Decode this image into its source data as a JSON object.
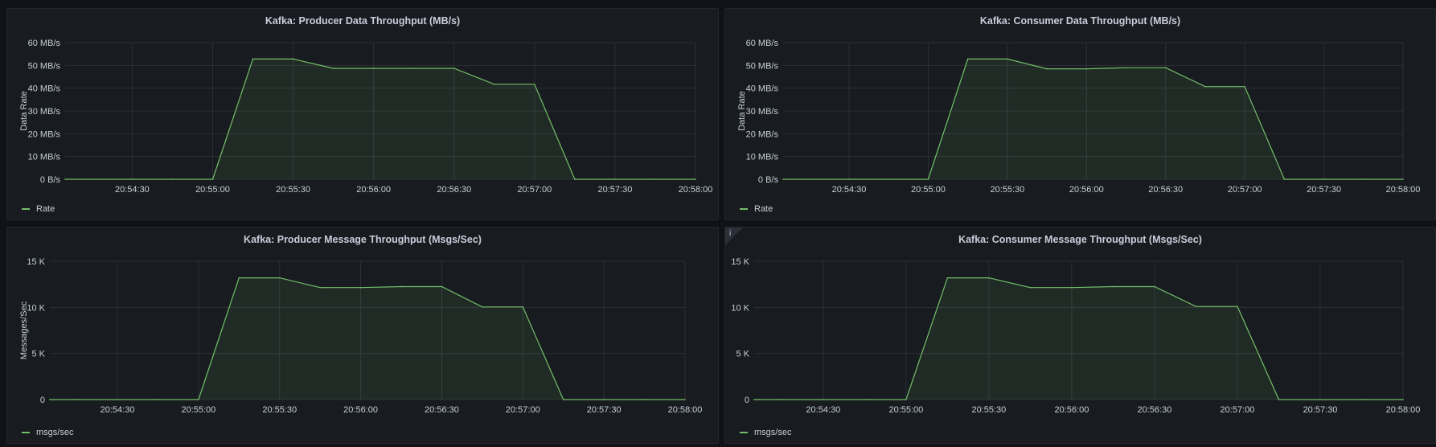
{
  "colors": {
    "line": "#73bf69",
    "grid": "#2c2f36",
    "axis_text": "#c7d0d9"
  },
  "chart_data": [
    {
      "type": "area",
      "title": "Kafka: Producer Data Throughput (MB/s)",
      "ylabel": "Data Rate",
      "xlabel": "",
      "y_ticks": [
        "0 B/s",
        "10 MB/s",
        "20 MB/s",
        "30 MB/s",
        "40 MB/s",
        "50 MB/s",
        "60 MB/s"
      ],
      "ylim": [
        0,
        60
      ],
      "x_ticks": [
        "20:54:30",
        "20:55:00",
        "20:55:30",
        "20:56:00",
        "20:56:30",
        "20:57:00",
        "20:57:30",
        "20:58:00"
      ],
      "xlim": [
        "20:54:05",
        "20:58:00"
      ],
      "grid": true,
      "legend_position": "bottom-left",
      "series": [
        {
          "name": "Rate",
          "x": [
            "20:54:05",
            "20:54:15",
            "20:54:30",
            "20:54:45",
            "20:55:00",
            "20:55:15",
            "20:55:30",
            "20:55:45",
            "20:56:00",
            "20:56:15",
            "20:56:30",
            "20:56:45",
            "20:57:00",
            "20:57:15",
            "20:57:30",
            "20:57:45",
            "20:58:00"
          ],
          "values": [
            0,
            0,
            0,
            0,
            0,
            52.8,
            52.8,
            48.7,
            48.7,
            48.7,
            48.7,
            41.7,
            41.7,
            0,
            0,
            0,
            0
          ]
        }
      ]
    },
    {
      "type": "area",
      "title": "Kafka: Consumer Data Throughput (MB/s)",
      "ylabel": "Data Rate",
      "xlabel": "",
      "y_ticks": [
        "0 B/s",
        "10 MB/s",
        "20 MB/s",
        "30 MB/s",
        "40 MB/s",
        "50 MB/s",
        "60 MB/s"
      ],
      "ylim": [
        0,
        60
      ],
      "x_ticks": [
        "20:54:30",
        "20:55:00",
        "20:55:30",
        "20:56:00",
        "20:56:30",
        "20:57:00",
        "20:57:30",
        "20:58:00"
      ],
      "xlim": [
        "20:54:05",
        "20:58:00"
      ],
      "grid": true,
      "legend_position": "bottom-left",
      "series": [
        {
          "name": "Rate",
          "x": [
            "20:54:05",
            "20:54:15",
            "20:54:30",
            "20:54:45",
            "20:55:00",
            "20:55:15",
            "20:55:30",
            "20:55:45",
            "20:56:00",
            "20:56:15",
            "20:56:30",
            "20:56:45",
            "20:57:00",
            "20:57:15",
            "20:57:30",
            "20:57:45",
            "20:58:00"
          ],
          "values": [
            0,
            0,
            0,
            0,
            0,
            52.8,
            52.8,
            48.5,
            48.5,
            49.0,
            49.0,
            40.7,
            40.7,
            0,
            0,
            0,
            0
          ]
        }
      ]
    },
    {
      "type": "area",
      "title": "Kafka: Producer Message Throughput (Msgs/Sec)",
      "ylabel": "Messages/Sec",
      "xlabel": "",
      "y_ticks": [
        "0",
        "5 K",
        "10 K",
        "15 K"
      ],
      "ylim": [
        0,
        15000
      ],
      "x_ticks": [
        "20:54:30",
        "20:55:00",
        "20:55:30",
        "20:56:00",
        "20:56:30",
        "20:57:00",
        "20:57:30",
        "20:58:00"
      ],
      "xlim": [
        "20:54:05",
        "20:58:00"
      ],
      "grid": true,
      "legend_position": "bottom-left",
      "series": [
        {
          "name": "msgs/sec",
          "x": [
            "20:54:05",
            "20:54:15",
            "20:54:30",
            "20:54:45",
            "20:55:00",
            "20:55:15",
            "20:55:30",
            "20:55:45",
            "20:56:00",
            "20:56:15",
            "20:56:30",
            "20:56:45",
            "20:57:00",
            "20:57:15",
            "20:57:30",
            "20:57:45",
            "20:58:00"
          ],
          "values": [
            0,
            0,
            0,
            0,
            0,
            13200,
            13200,
            12150,
            12150,
            12250,
            12250,
            10050,
            10050,
            0,
            0,
            0,
            0
          ]
        }
      ]
    },
    {
      "type": "area",
      "title": "Kafka: Consumer Message Throughput (Msgs/Sec)",
      "ylabel": "",
      "xlabel": "",
      "y_ticks": [
        "0",
        "5 K",
        "10 K",
        "15 K"
      ],
      "ylim": [
        0,
        15000
      ],
      "x_ticks": [
        "20:54:30",
        "20:55:00",
        "20:55:30",
        "20:56:00",
        "20:56:30",
        "20:57:00",
        "20:57:30",
        "20:58:00"
      ],
      "xlim": [
        "20:54:05",
        "20:58:00"
      ],
      "grid": true,
      "legend_position": "bottom-left",
      "info_badge": "i",
      "series": [
        {
          "name": "msgs/sec",
          "x": [
            "20:54:05",
            "20:54:15",
            "20:54:30",
            "20:54:45",
            "20:55:00",
            "20:55:15",
            "20:55:30",
            "20:55:45",
            "20:56:00",
            "20:56:15",
            "20:56:30",
            "20:56:45",
            "20:57:00",
            "20:57:15",
            "20:57:30",
            "20:57:45",
            "20:58:00"
          ],
          "values": [
            0,
            0,
            0,
            0,
            0,
            13200,
            13200,
            12150,
            12150,
            12250,
            12250,
            10100,
            10100,
            0,
            0,
            0,
            0
          ]
        }
      ]
    }
  ]
}
